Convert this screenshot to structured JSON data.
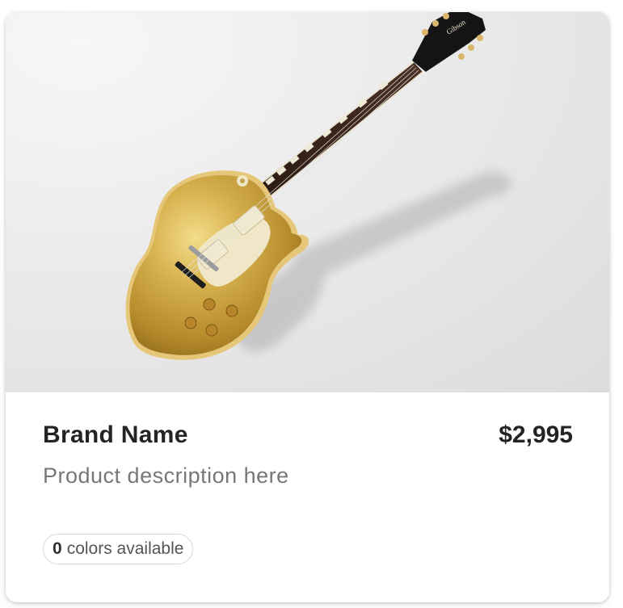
{
  "product": {
    "image": {
      "subject": "gold top electric guitar",
      "background_color": "#e4e4e4"
    },
    "brand": "Brand Name",
    "price": "$2,995",
    "description": "Product description here",
    "colors": {
      "count": "0",
      "label": "colors available"
    }
  },
  "colors": {
    "text_primary": "#242424",
    "text_secondary": "#777777",
    "pill_border": "#d9d9d9",
    "guitar_gold": "#c8a23c"
  }
}
